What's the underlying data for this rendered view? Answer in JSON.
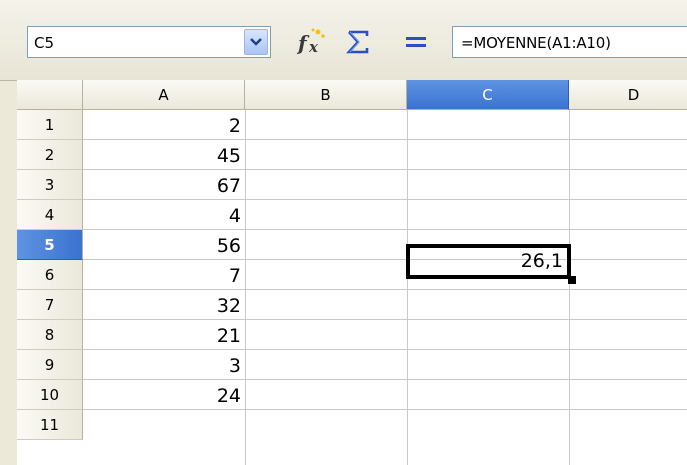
{
  "formula_bar": {
    "cell_reference": "C5",
    "formula": "=MOYENNE(A1:A10)",
    "icons": [
      "function-wizard-icon",
      "sum-icon",
      "equals-icon",
      "dropdown-arrow-icon"
    ]
  },
  "columns": [
    "A",
    "B",
    "C",
    "D"
  ],
  "selected_column": "C",
  "rows": [
    "1",
    "2",
    "3",
    "4",
    "5",
    "6",
    "7",
    "8",
    "9",
    "10",
    "11"
  ],
  "selected_row": "5",
  "column_a_values": [
    "2",
    "45",
    "67",
    "4",
    "56",
    "7",
    "32",
    "21",
    "3",
    "24"
  ],
  "active_cell": {
    "address": "C5",
    "value": "26,1"
  },
  "colors": {
    "selection_header": "#3a72d0",
    "grid_line": "#c9c9c9",
    "header_background": "#ebe8da"
  }
}
